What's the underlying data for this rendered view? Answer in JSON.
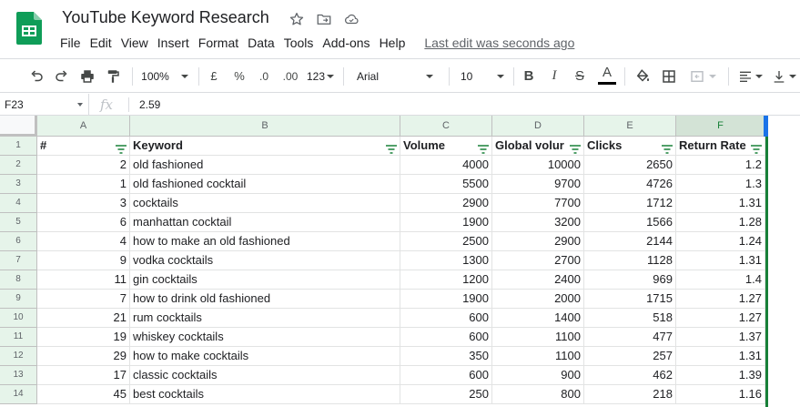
{
  "doc": {
    "title": "YouTube Keyword Research",
    "icons": [
      "star-icon",
      "move-to-folder-icon",
      "cloud-status-icon"
    ]
  },
  "menu": {
    "items": [
      "File",
      "Edit",
      "View",
      "Insert",
      "Format",
      "Data",
      "Tools",
      "Add-ons",
      "Help"
    ],
    "last_edit": "Last edit was seconds ago"
  },
  "toolbar": {
    "zoom": "100%",
    "currency": "£",
    "percent": "%",
    "decrease_decimals": ".0",
    "increase_decimals": ".00",
    "number_format": "123",
    "font": "Arial",
    "font_size": "10",
    "bold": "B",
    "italic": "I",
    "strikethrough": "S",
    "text_color_letter": "A",
    "text_color": "#000000"
  },
  "formula_bar": {
    "name_box": "F23",
    "fx": "fx",
    "value": "2.59"
  },
  "colors": {
    "header_bg": "#e6f4ea",
    "selected_col_bg": "#d3e3d6",
    "filter_green": "#188038",
    "selection_blue": "#1a73e8"
  },
  "sheet": {
    "column_letters": [
      "A",
      "B",
      "C",
      "D",
      "E",
      "F"
    ],
    "row_numbers": [
      "1",
      "2",
      "3",
      "4",
      "5",
      "6",
      "7",
      "8",
      "9",
      "10",
      "11",
      "12",
      "13",
      "14"
    ],
    "headers": [
      "#",
      "Keyword",
      "Volume",
      "Global volur",
      "Clicks",
      "Return Rate"
    ],
    "rows": [
      [
        "2",
        "old fashioned",
        "4000",
        "10000",
        "2650",
        "1.2"
      ],
      [
        "1",
        "old fashioned cocktail",
        "5500",
        "9700",
        "4726",
        "1.3"
      ],
      [
        "3",
        "cocktails",
        "2900",
        "7700",
        "1712",
        "1.31"
      ],
      [
        "6",
        "manhattan cocktail",
        "1900",
        "3200",
        "1566",
        "1.28"
      ],
      [
        "4",
        "how to make an old fashioned",
        "2500",
        "2900",
        "2144",
        "1.24"
      ],
      [
        "9",
        "vodka cocktails",
        "1300",
        "2700",
        "1128",
        "1.31"
      ],
      [
        "11",
        "gin cocktails",
        "1200",
        "2400",
        "969",
        "1.4"
      ],
      [
        "7",
        "how to drink old fashioned",
        "1900",
        "2000",
        "1715",
        "1.27"
      ],
      [
        "21",
        "rum cocktails",
        "600",
        "1400",
        "518",
        "1.27"
      ],
      [
        "19",
        "whiskey cocktails",
        "600",
        "1100",
        "477",
        "1.37"
      ],
      [
        "29",
        "how to make cocktails",
        "350",
        "1100",
        "257",
        "1.31"
      ],
      [
        "17",
        "classic cocktails",
        "600",
        "900",
        "462",
        "1.39"
      ],
      [
        "45",
        "best cocktails",
        "250",
        "800",
        "218",
        "1.16"
      ]
    ]
  }
}
